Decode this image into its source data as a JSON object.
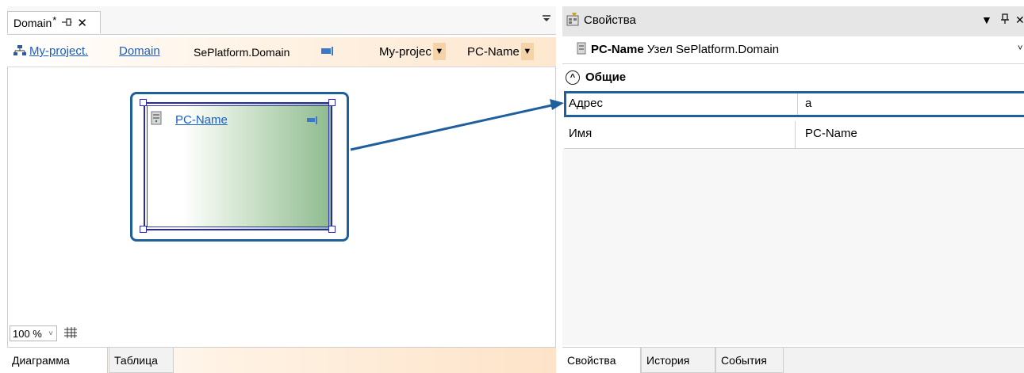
{
  "left": {
    "tab": {
      "title": "Domain",
      "dirty_mark": "*",
      "pin_glyph": "⊣",
      "close_glyph": "✕"
    },
    "tab_menu_glyph": "▼",
    "breadcrumb": {
      "project_link": "My-project.",
      "domain_link": "Domain",
      "path_text": "SePlatform.Domain"
    },
    "combos": [
      {
        "value": "My-projec"
      },
      {
        "value": "PC-Name"
      }
    ],
    "node": {
      "name": "PC-Name"
    },
    "zoom": {
      "value": "100 %",
      "grid_icon": "grid-icon"
    },
    "bottom_tabs": [
      {
        "label": "Диаграмма",
        "active": true
      },
      {
        "label": "Таблица",
        "active": false
      }
    ]
  },
  "right": {
    "title": "Свойства",
    "controls": {
      "dropdown": "▼",
      "pin": "ᵖ",
      "close": "✕"
    },
    "header": {
      "name": "PC-Name",
      "type_text": "Узел SePlatform.Domain"
    },
    "section": {
      "label": "Общие"
    },
    "properties": [
      {
        "name": "Адрес",
        "value": "a",
        "selected": true
      },
      {
        "name": "Имя",
        "value": "PC-Name",
        "selected": false
      }
    ],
    "bottom_tabs": [
      {
        "label": "Свойства",
        "active": true
      },
      {
        "label": "История",
        "active": false
      },
      {
        "label": "События",
        "active": false
      }
    ]
  },
  "colors": {
    "accent": "#1f5f9c",
    "link": "#1a5fc7",
    "selection_handle": "#2a2ad0",
    "node_gradient_end": "#8fbb8f"
  }
}
